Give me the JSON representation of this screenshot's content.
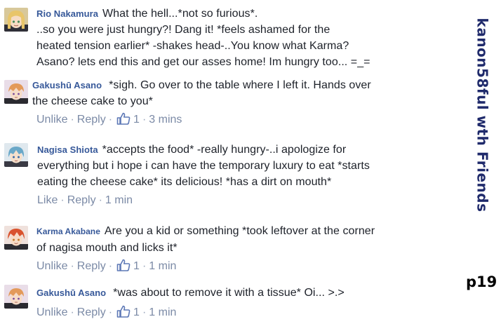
{
  "sidebar": {
    "title": "kanon58ful wth Friends",
    "page_label": "p19"
  },
  "comments": [
    {
      "author": "Rio Nakamura",
      "lines": [
        "What the hell...*not so furious*.",
        "..so you were just hungry?! Dang it! *feels ashamed for the",
        "heated tension earlier* -shakes head-..You know what Karma?",
        "Asano? lets end this and get our asses home! Im hungry too... =_="
      ]
    },
    {
      "author": "Gakushū Asano",
      "lines": [
        "*sigh. Go over to the table where I left it. Hands over",
        "the cheese cake to you*"
      ],
      "actions": {
        "unlike": "Unlike",
        "reply": "Reply",
        "likes": "1",
        "time": "3 mins"
      }
    },
    {
      "author": "Nagisa Shiota",
      "lines": [
        "*accepts the food* -really hungry-..i apologize for",
        "everything but i hope i can have the temporary luxury to eat *starts",
        "eating the cheese cake* its delicious! *has a dirt on mouth*"
      ],
      "actions": {
        "like": "Like",
        "reply": "Reply",
        "time": "1 min"
      }
    },
    {
      "author": "Karma Akabane",
      "lines": [
        "Are you a kid or something *took leftover at the corner",
        "of nagisa mouth and licks it*"
      ],
      "actions": {
        "unlike": "Unlike",
        "reply": "Reply",
        "likes": "1",
        "time": "1 min"
      }
    },
    {
      "author": "Gakushū Asano",
      "lines": [
        "*was about to remove it with a tissue* Oi... >.>"
      ],
      "actions": {
        "unlike": "Unlike",
        "reply": "Reply",
        "likes": "1",
        "time": "1 min"
      }
    }
  ],
  "colors": {
    "author_link": "#365899",
    "action_link": "#7b8aa6",
    "sidebar_title": "#1f2a6b"
  },
  "icons": {
    "like": "thumbs-up-icon",
    "avatars": [
      "blonde-girl-avatar",
      "orange-hair-boy-avatar",
      "blue-hair-boy-avatar",
      "red-hair-boy-avatar",
      "orange-hair-boy-avatar"
    ]
  }
}
